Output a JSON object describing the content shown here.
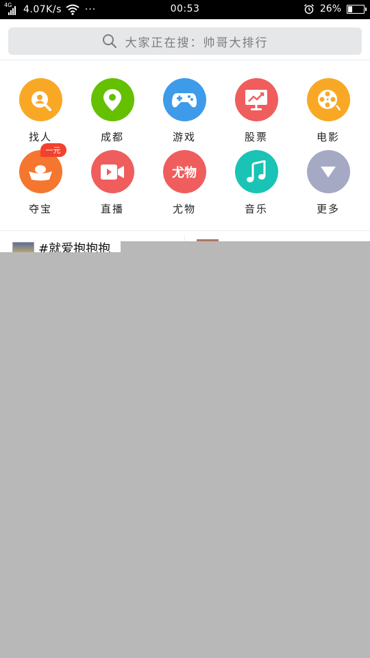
{
  "status_bar": {
    "network_type": "4G",
    "speed": "4.07K/s",
    "more_dots": "···",
    "time": "00:53",
    "battery_percent": "26%",
    "battery_level": 0.26,
    "icons": [
      "signal-icon",
      "wifi-icon",
      "alarm-icon",
      "battery-icon"
    ]
  },
  "search": {
    "placeholder": "大家正在搜：帅哥大排行",
    "icon": "search-icon"
  },
  "grid": {
    "items": [
      {
        "label": "找人",
        "icon": "find-person-icon",
        "color": "#f9a825"
      },
      {
        "label": "成都",
        "icon": "location-pin-icon",
        "color": "#64c000"
      },
      {
        "label": "游戏",
        "icon": "gamepad-icon",
        "color": "#3d9be9"
      },
      {
        "label": "股票",
        "icon": "stock-chart-icon",
        "color": "#ef5d5d"
      },
      {
        "label": "电影",
        "icon": "film-reel-icon",
        "color": "#f9a825"
      },
      {
        "label": "夺宝",
        "icon": "gold-ingot-icon",
        "color": "#f5762e",
        "badge": "一元"
      },
      {
        "label": "直播",
        "icon": "video-camera-icon",
        "color": "#ef5d5d"
      },
      {
        "label": "尤物",
        "icon": "youwu-text-icon",
        "color": "#ef5d5d",
        "icon_text": "尤物"
      },
      {
        "label": "音乐",
        "icon": "music-note-icon",
        "color": "#19c3b5"
      },
      {
        "label": "更多",
        "icon": "triangle-down-icon",
        "color": "#a5a9c4"
      }
    ]
  },
  "feed": {
    "item1_text": "#就爱抱抱抱"
  },
  "colors": {
    "overlay": "#b8b8b8",
    "search_bg": "#e6e7e9"
  }
}
